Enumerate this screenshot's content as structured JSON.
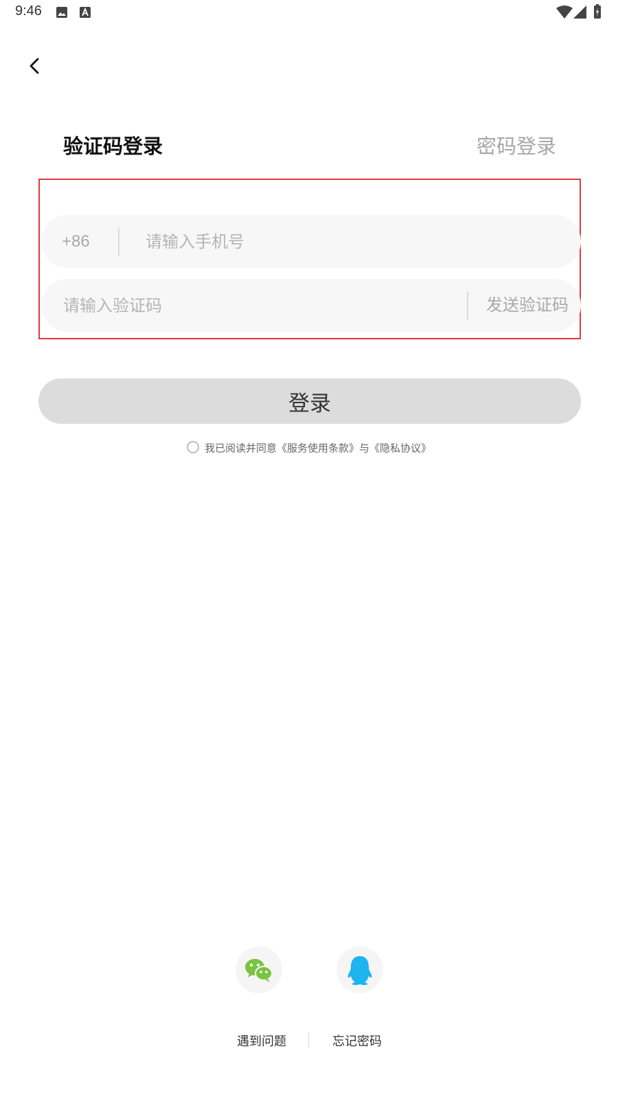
{
  "status_bar": {
    "time": "9:46"
  },
  "header": {
    "back_icon": "chevron-left-icon"
  },
  "tabs": {
    "sms_login": "验证码登录",
    "password_login": "密码登录"
  },
  "form": {
    "country_code": "+86",
    "phone_placeholder": "请输入手机号",
    "code_placeholder": "请输入验证码",
    "send_code_label": "发送验证码"
  },
  "login_button": {
    "label": "登录"
  },
  "agreement": {
    "text": "我已阅读并同意《服务使用条款》与《隐私协议》"
  },
  "social": {
    "wechat_icon": "wechat-icon",
    "qq_icon": "qq-icon"
  },
  "footer": {
    "problem_link": "遇到问题",
    "forgot_password_link": "忘记密码"
  },
  "colors": {
    "highlight_border": "#e0383e",
    "wechat_green": "#7bc342",
    "qq_blue": "#1eb4f0"
  }
}
